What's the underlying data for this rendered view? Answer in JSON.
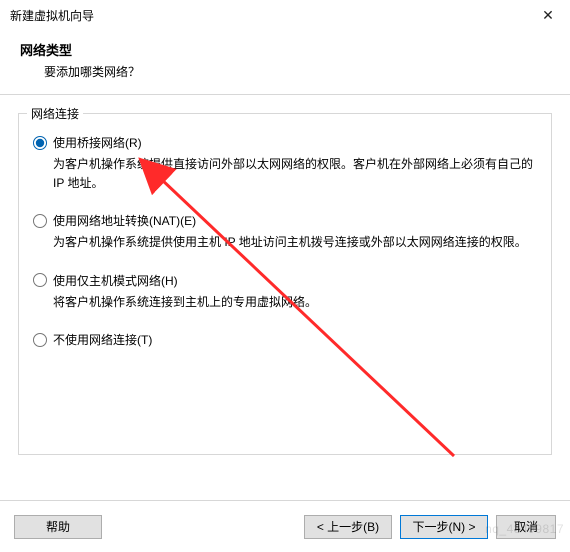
{
  "window": {
    "title": "新建虚拟机向导",
    "close_label": "✕"
  },
  "header": {
    "heading": "网络类型",
    "subheading": "要添加哪类网络？"
  },
  "fieldset": {
    "legend": "网络连接"
  },
  "options": {
    "bridged": {
      "label": "使用桥接网络(R)",
      "desc": "为客户机操作系统提供直接访问外部以太网网络的权限。客户机在外部网络上必须有自己的 IP 地址。",
      "checked": true
    },
    "nat": {
      "label": "使用网络地址转换(NAT)(E)",
      "desc": "为客户机操作系统提供使用主机 IP 地址访问主机拨号连接或外部以太网网络连接的权限。",
      "checked": false
    },
    "hostonly": {
      "label": "使用仅主机模式网络(H)",
      "desc": "将客户机操作系统连接到主机上的专用虚拟网络。",
      "checked": false
    },
    "none": {
      "label": "不使用网络连接(T)",
      "checked": false
    }
  },
  "footer": {
    "help": "帮助",
    "back": "< 上一步(B)",
    "next": "下一步(N) >",
    "cancel": "取消"
  },
  "watermark": "nq_43499817"
}
